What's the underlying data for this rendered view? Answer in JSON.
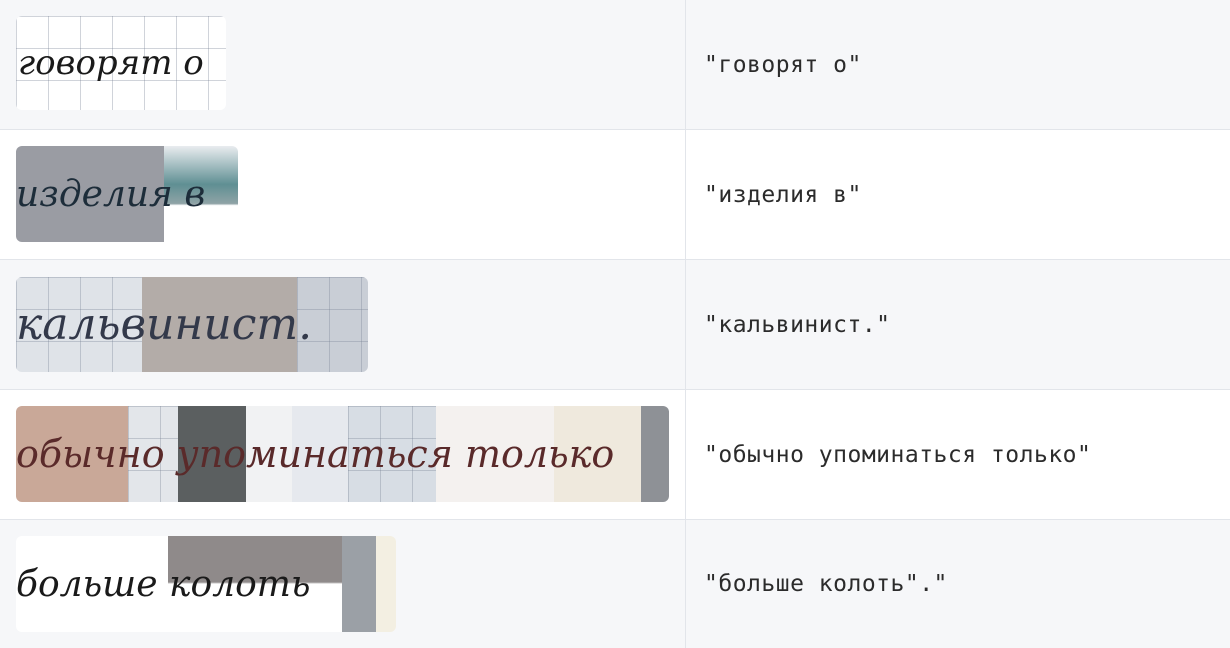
{
  "rows": [
    {
      "transcription": "\"говорят о\"",
      "handwriting": "говорят о"
    },
    {
      "transcription": "\"изделия в\"",
      "handwriting": "изделия в"
    },
    {
      "transcription": "\"кальвинист.\"",
      "handwriting": "кальвинист."
    },
    {
      "transcription": "\"обычно упоминаться только\"",
      "handwriting": "обычно упоминаться только"
    },
    {
      "transcription": "\"больше колоть\".\"",
      "handwriting": "больше колоть"
    }
  ]
}
